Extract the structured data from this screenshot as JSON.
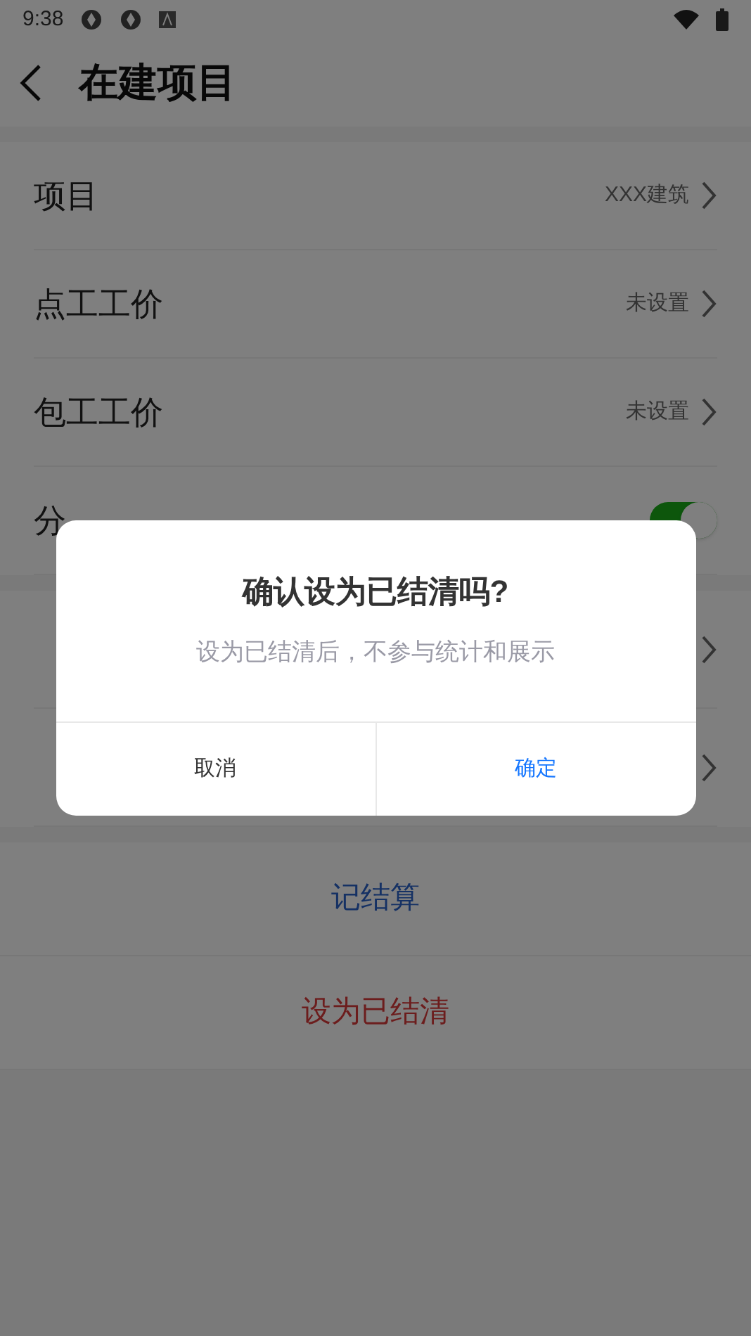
{
  "status_bar": {
    "time": "9:38"
  },
  "header": {
    "title": "在建项目"
  },
  "settings": [
    {
      "kind": "link",
      "label": "项目",
      "value": "XXX建筑"
    },
    {
      "kind": "link",
      "label": "点工工价",
      "value": "未设置"
    },
    {
      "kind": "link",
      "label": "包工工价",
      "value": "未设置"
    },
    {
      "kind": "toggle",
      "label": "分",
      "on": true
    }
  ],
  "summary": [
    {
      "kind": "link"
    },
    {
      "kind": "link"
    }
  ],
  "actions": [
    {
      "label": "记结算",
      "kind": "primary"
    },
    {
      "label": "设为已结清",
      "kind": "danger"
    }
  ],
  "dialog": {
    "title": "确认设为已结清吗?",
    "message": "设为已结清后，不参与统计和展示",
    "buttons": [
      {
        "label": "取消",
        "kind": "cancel"
      },
      {
        "label": "确定",
        "kind": "confirm"
      }
    ]
  }
}
